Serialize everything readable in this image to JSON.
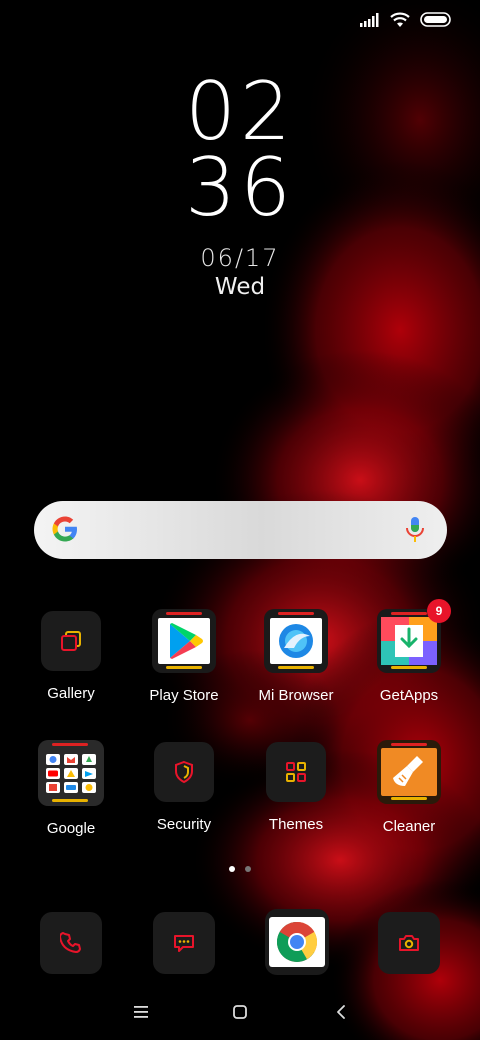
{
  "status_bar": {
    "icons": [
      "signal-icon",
      "wifi-icon",
      "battery-icon"
    ]
  },
  "clock": {
    "hours": "02",
    "minutes": "36",
    "date": "06/17",
    "day": "Wed"
  },
  "search": {
    "icons": [
      "google-g-icon",
      "mic-icon"
    ]
  },
  "apps": [
    {
      "label": "Gallery",
      "icon": "gallery-icon"
    },
    {
      "label": "Play Store",
      "icon": "play-store-icon"
    },
    {
      "label": "Mi Browser",
      "icon": "mi-browser-icon"
    },
    {
      "label": "GetApps",
      "icon": "getapps-icon",
      "badge": "9"
    },
    {
      "label": "Google",
      "icon": "google-folder-icon"
    },
    {
      "label": "Security",
      "icon": "security-icon"
    },
    {
      "label": "Themes",
      "icon": "themes-icon"
    },
    {
      "label": "Cleaner",
      "icon": "cleaner-icon"
    }
  ],
  "page_indicator": {
    "pages": 2,
    "current": 1
  },
  "dock": [
    {
      "icon": "phone-icon"
    },
    {
      "icon": "messages-icon"
    },
    {
      "icon": "chrome-icon"
    },
    {
      "icon": "camera-icon"
    }
  ],
  "nav_bar": [
    "menu-icon",
    "home-icon",
    "back-icon"
  ],
  "colors": {
    "accent_red": "#e8142a",
    "accent_yellow": "#e8b200",
    "background": "#000000"
  }
}
